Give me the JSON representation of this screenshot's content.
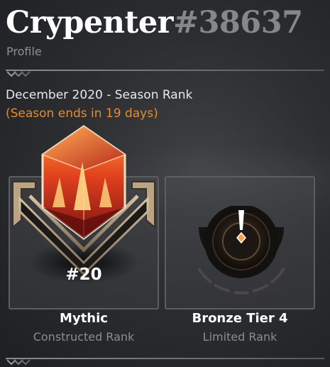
{
  "profile": {
    "name": "Crypenter",
    "tag": "#38637",
    "subtitle": "Profile"
  },
  "season": {
    "title": "December 2020 - Season Rank",
    "ends": "(Season ends in 19 days)"
  },
  "ranks": {
    "constructed": {
      "tier": "Mythic",
      "type": "Constructed Rank",
      "placement": "#20",
      "icon": "mythic-gem-icon"
    },
    "limited": {
      "tier": "Bronze Tier 4",
      "type": "Limited Rank",
      "icon": "bronze-rank-icon"
    }
  },
  "colors": {
    "accent_orange": "#e98b2d",
    "tag_gray": "#858789",
    "subtle_text": "#8b8d90"
  }
}
